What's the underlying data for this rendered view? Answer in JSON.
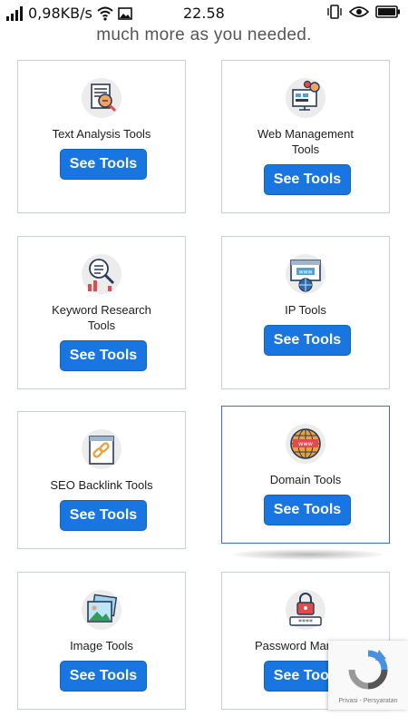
{
  "status_bar": {
    "speed": "0,98KB/s",
    "time": "22.58",
    "icons": [
      "signal-icon",
      "wifi-icon",
      "image-icon",
      "vibrate-icon",
      "eye-icon",
      "battery-icon"
    ]
  },
  "intro_text": "much more as you needed.",
  "cards": [
    {
      "title": "Text Analysis Tools",
      "button": "See Tools",
      "icon": "text-analysis-icon"
    },
    {
      "title": "Web Management Tools",
      "button": "See Tools",
      "icon": "web-management-icon"
    },
    {
      "title": "Keyword Research Tools",
      "button": "See Tools",
      "icon": "keyword-research-icon"
    },
    {
      "title": "IP Tools",
      "button": "See Tools",
      "icon": "ip-tools-icon"
    },
    {
      "title": "SEO Backlink Tools",
      "button": "See Tools",
      "icon": "backlink-icon"
    },
    {
      "title": "Domain Tools",
      "button": "See Tools",
      "icon": "domain-icon"
    },
    {
      "title": "Image Tools",
      "button": "See Tools",
      "icon": "image-tools-icon"
    },
    {
      "title": "Password Manager",
      "button": "See Tools",
      "icon": "password-icon"
    }
  ],
  "recaptcha": {
    "text": "Privasi - Persyaratan"
  },
  "colors": {
    "button": "#1976e0",
    "card_border": "#c9cfd8",
    "active_border": "#3a6fc4"
  }
}
